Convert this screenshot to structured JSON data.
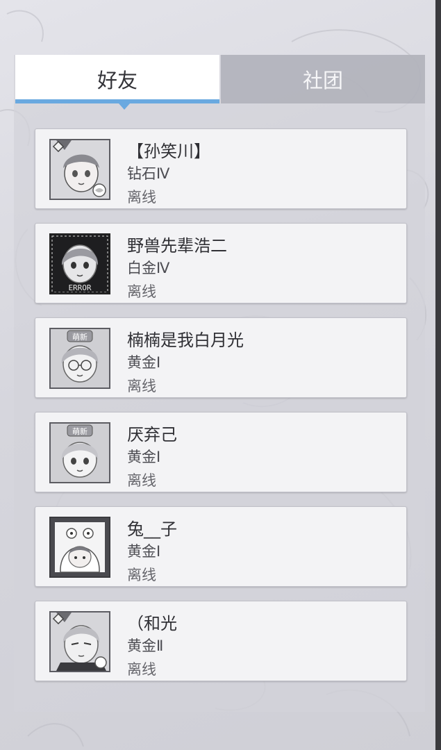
{
  "tabs": {
    "friends_label": "好友",
    "club_label": "社团",
    "active": "friends"
  },
  "colors": {
    "accent": "#6aa9e0",
    "card_bg": "#f3f3f5",
    "panel_bg": "#d2d3da"
  },
  "friends": [
    {
      "name": "【孙笑川】",
      "rank": "钻石Ⅳ",
      "status": "离线",
      "avatar_icon": "anime-girl-avatar-diamond-frame-icon"
    },
    {
      "name": "野兽先辈浩二",
      "rank": "白金Ⅳ",
      "status": "离线",
      "avatar_icon": "anime-girl-avatar-error-frame-icon"
    },
    {
      "name": "楠楠是我白月光",
      "rank": "黄金Ⅰ",
      "status": "离线",
      "avatar_icon": "anime-girl-glasses-avatar-cute-badge-icon"
    },
    {
      "name": "厌弃己",
      "rank": "黄金Ⅰ",
      "status": "离线",
      "avatar_icon": "anime-girl-avatar-cute-badge-icon"
    },
    {
      "name": "兔__子",
      "rank": "黄金Ⅰ",
      "status": "离线",
      "avatar_icon": "chibi-frog-hood-avatar-icon"
    },
    {
      "name": "（和光",
      "rank": "黄金Ⅱ",
      "status": "离线",
      "avatar_icon": "anime-girl-avatar-diamond-frame-icon"
    }
  ],
  "avatar_badges": {
    "cute_badge_text": "萌新",
    "error_badge_text": "ERROR"
  }
}
